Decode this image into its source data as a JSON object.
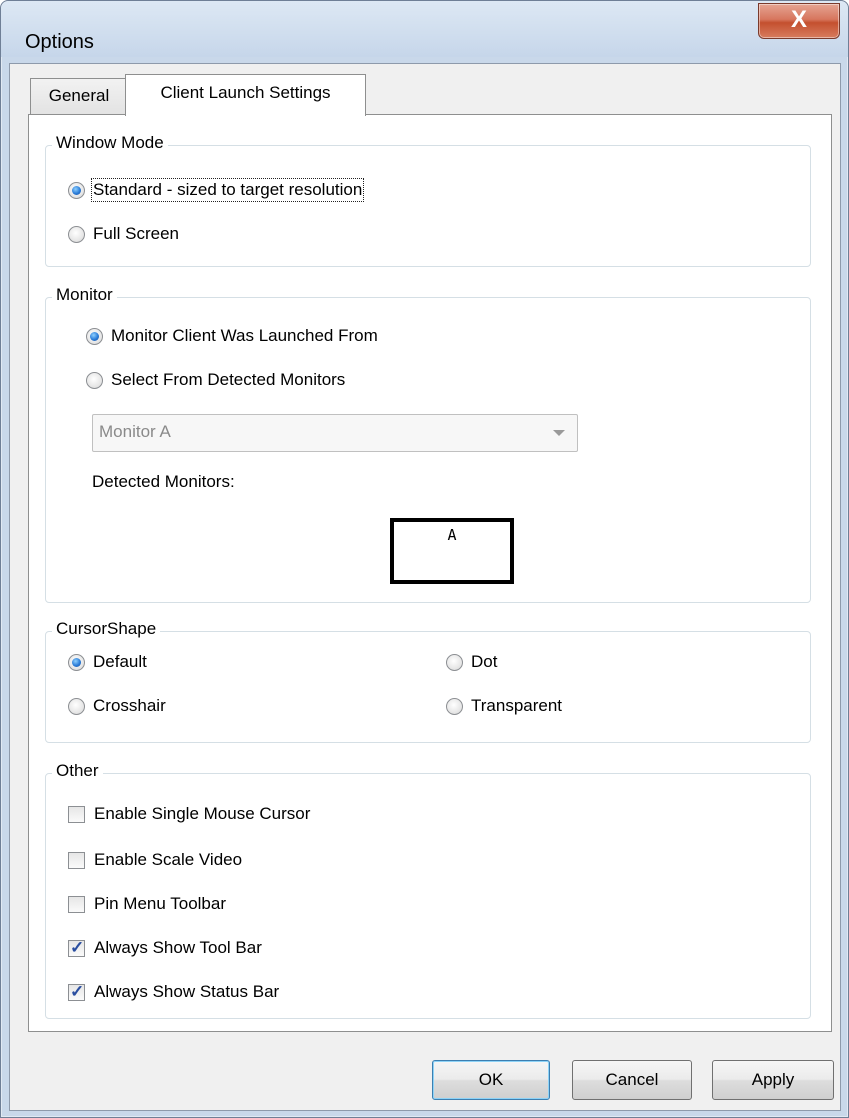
{
  "window": {
    "title": "Options",
    "close_label": "X"
  },
  "tabs": [
    {
      "label": "General",
      "active": false
    },
    {
      "label": "Client Launch Settings",
      "active": true
    }
  ],
  "window_mode": {
    "legend": "Window Mode",
    "options": [
      {
        "label": "Standard - sized to target resolution",
        "selected": true
      },
      {
        "label": "Full Screen",
        "selected": false
      }
    ]
  },
  "monitor": {
    "legend": "Monitor",
    "options": [
      {
        "label": "Monitor Client Was Launched From",
        "selected": true
      },
      {
        "label": "Select From Detected Monitors",
        "selected": false
      }
    ],
    "select_value": "Monitor A",
    "detected_label": "Detected Monitors:",
    "monitors": [
      "A"
    ]
  },
  "cursor_shape": {
    "legend": "CursorShape",
    "options": [
      {
        "label": "Default",
        "selected": true
      },
      {
        "label": "Dot",
        "selected": false
      },
      {
        "label": "Crosshair",
        "selected": false
      },
      {
        "label": "Transparent",
        "selected": false
      }
    ]
  },
  "other": {
    "legend": "Other",
    "checkboxes": [
      {
        "label": "Enable Single Mouse Cursor",
        "checked": false
      },
      {
        "label": "Enable Scale Video",
        "checked": false
      },
      {
        "label": "Pin Menu Toolbar",
        "checked": false
      },
      {
        "label": "Always Show Tool Bar",
        "checked": true
      },
      {
        "label": "Always Show Status Bar",
        "checked": true
      }
    ]
  },
  "buttons": {
    "ok": "OK",
    "cancel": "Cancel",
    "apply": "Apply"
  }
}
